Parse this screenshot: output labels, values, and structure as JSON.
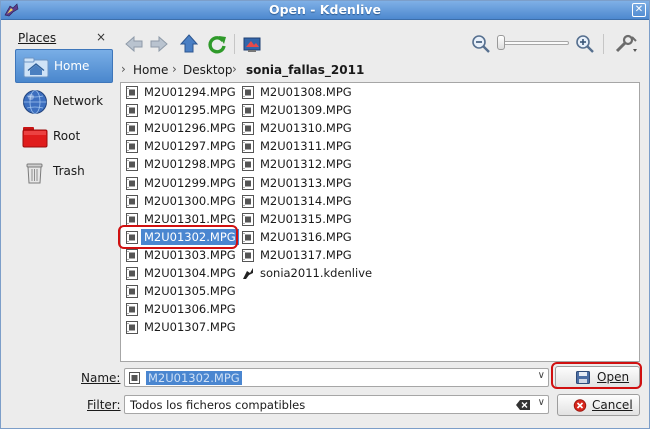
{
  "window": {
    "title": "Open - Kdenlive",
    "close_label": "✕"
  },
  "places": {
    "header": "Places",
    "close_label": "×",
    "items": [
      {
        "label": "Home",
        "icon": "home-folder-icon",
        "active": true
      },
      {
        "label": "Network",
        "icon": "globe-icon",
        "active": false
      },
      {
        "label": "Root",
        "icon": "red-folder-icon",
        "active": false
      },
      {
        "label": "Trash",
        "icon": "trash-icon",
        "active": false
      }
    ]
  },
  "toolbar": {
    "icons": [
      "back-arrow-icon",
      "forward-arrow-icon",
      "up-arrow-icon",
      "reload-icon",
      "preview-icon",
      "zoom-out-icon",
      "zoom-in-icon",
      "options-icon"
    ]
  },
  "breadcrumb": [
    "Home",
    "Desktop",
    "sonia_fallas_2011"
  ],
  "files": {
    "col1": [
      "M2U01294.MPG",
      "M2U01295.MPG",
      "M2U01296.MPG",
      "M2U01297.MPG",
      "M2U01298.MPG",
      "M2U01299.MPG",
      "M2U01300.MPG",
      "M2U01301.MPG",
      "M2U01302.MPG",
      "M2U01303.MPG",
      "M2U01304.MPG",
      "M2U01305.MPG",
      "M2U01306.MPG",
      "M2U01307.MPG"
    ],
    "col2": [
      "M2U01308.MPG",
      "M2U01309.MPG",
      "M2U01310.MPG",
      "M2U01311.MPG",
      "M2U01312.MPG",
      "M2U01313.MPG",
      "M2U01314.MPG",
      "M2U01315.MPG",
      "M2U01316.MPG",
      "M2U01317.MPG",
      "sonia2011.kdenlive"
    ],
    "selected": "M2U01302.MPG"
  },
  "name_row": {
    "label": "Name:",
    "value": "M2U01302.MPG"
  },
  "filter_row": {
    "label": "Filter:",
    "value": "Todos los ficheros compatibles"
  },
  "buttons": {
    "open": "Open",
    "cancel": "Cancel"
  },
  "colors": {
    "selection": "#4a86d0",
    "highlight": "#d01010",
    "titlebar": "#5a93d6"
  }
}
